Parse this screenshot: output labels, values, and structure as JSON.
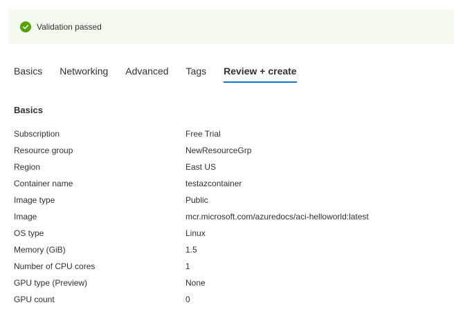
{
  "banner": {
    "message": "Validation passed",
    "status_color": "#57a300",
    "icon": "check-circle-icon"
  },
  "tabs": [
    {
      "label": "Basics",
      "active": false
    },
    {
      "label": "Networking",
      "active": false
    },
    {
      "label": "Advanced",
      "active": false
    },
    {
      "label": "Tags",
      "active": false
    },
    {
      "label": "Review + create",
      "active": true
    }
  ],
  "accent_color": "#0078d4",
  "section": {
    "title": "Basics",
    "rows": [
      {
        "key": "Subscription",
        "value": "Free Trial"
      },
      {
        "key": "Resource group",
        "value": "NewResourceGrp"
      },
      {
        "key": "Region",
        "value": "East US"
      },
      {
        "key": "Container name",
        "value": "testazcontainer"
      },
      {
        "key": "Image type",
        "value": "Public"
      },
      {
        "key": "Image",
        "value": "mcr.microsoft.com/azuredocs/aci-helloworld:latest"
      },
      {
        "key": "OS type",
        "value": "Linux"
      },
      {
        "key": "Memory (GiB)",
        "value": "1.5"
      },
      {
        "key": "Number of CPU cores",
        "value": "1"
      },
      {
        "key": "GPU type (Preview)",
        "value": "None"
      },
      {
        "key": "GPU count",
        "value": "0"
      }
    ]
  }
}
